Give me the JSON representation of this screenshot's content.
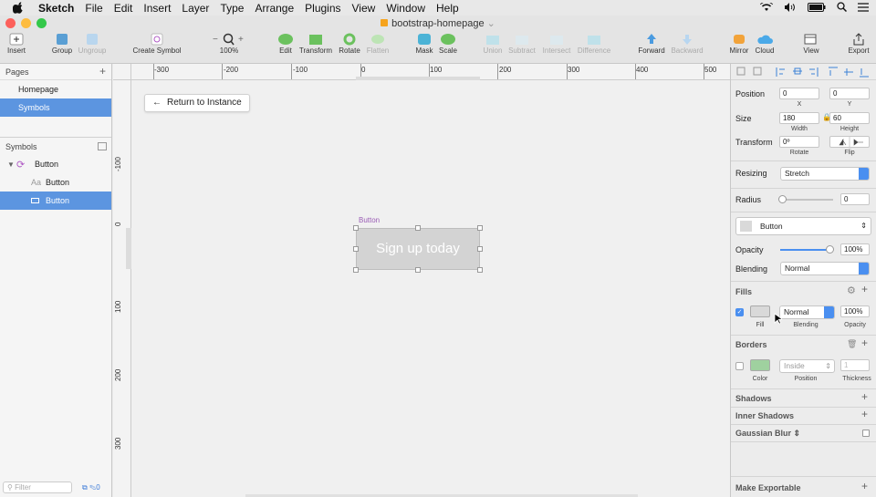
{
  "menubar": {
    "app": "Sketch",
    "items": [
      "File",
      "Edit",
      "Insert",
      "Layer",
      "Type",
      "Arrange",
      "Plugins",
      "View",
      "Window",
      "Help"
    ]
  },
  "window": {
    "title": "bootstrap-homepage"
  },
  "toolbar": {
    "insert": "Insert",
    "group": "Group",
    "ungroup": "Ungroup",
    "create_symbol": "Create Symbol",
    "zoom": "100%",
    "edit": "Edit",
    "transform": "Transform",
    "rotate": "Rotate",
    "flatten": "Flatten",
    "mask": "Mask",
    "scale": "Scale",
    "union": "Union",
    "subtract": "Subtract",
    "intersect": "Intersect",
    "difference": "Difference",
    "forward": "Forward",
    "backward": "Backward",
    "mirror": "Mirror",
    "cloud": "Cloud",
    "view": "View",
    "export": "Export"
  },
  "sidebar": {
    "pages_header": "Pages",
    "pages": [
      "Homepage",
      "Symbols"
    ],
    "symbols_header": "Symbols",
    "layers": [
      {
        "label": "Button"
      },
      {
        "label": "Button"
      },
      {
        "label": "Button"
      }
    ],
    "filter_placeholder": "Filter",
    "count": "0"
  },
  "canvas": {
    "return_label": "Return to Instance",
    "artboard_label": "Button",
    "button_text": "Sign up today",
    "hruler": [
      "-300",
      "-200",
      "-100",
      "0",
      "100",
      "200",
      "300",
      "400",
      "500"
    ],
    "vruler": [
      "-100",
      "0",
      "100",
      "200",
      "300"
    ]
  },
  "inspector": {
    "position_label": "Position",
    "x": "0",
    "y": "0",
    "x_label": "X",
    "y_label": "Y",
    "size_label": "Size",
    "width": "180",
    "height": "60",
    "width_label": "Width",
    "height_label": "Height",
    "transform_label": "Transform",
    "rotate": "0º",
    "rotate_label": "Rotate",
    "flip_label": "Flip",
    "resizing_label": "Resizing",
    "resizing": "Stretch",
    "radius_label": "Radius",
    "radius": "0",
    "style_name": "Button",
    "opacity_label": "Opacity",
    "opacity": "100%",
    "opacity_level": 1.0,
    "blending_label": "Blending",
    "blending": "Normal",
    "fills_header": "Fills",
    "fill_blend": "Normal",
    "fill_opacity": "100%",
    "fill_label": "Fill",
    "fill_blend_label": "Blending",
    "fill_opacity_label": "Opacity",
    "borders_header": "Borders",
    "border_pos": "Inside",
    "border_thick": "1",
    "color_label": "Color",
    "position_sub": "Position",
    "thickness_label": "Thickness",
    "shadows": "Shadows",
    "inner_shadows": "Inner Shadows",
    "gaussian": "Gaussian Blur",
    "make_exportable": "Make Exportable"
  },
  "colors": {
    "accent": "#5c95e0",
    "fill_swatch": "#d9d9d9",
    "border_swatch": "#9fd19f",
    "button_bg": "#d3d3d3"
  }
}
